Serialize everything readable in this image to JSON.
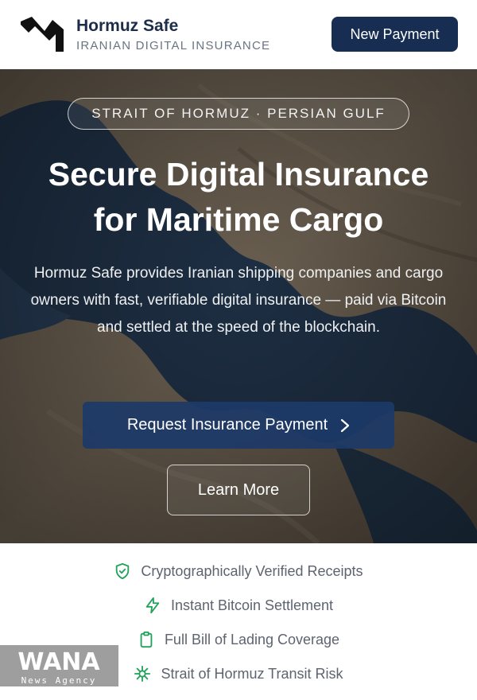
{
  "header": {
    "brand_title": "Hormuz Safe",
    "brand_subtitle": "IRANIAN DIGITAL INSURANCE",
    "new_payment_label": "New Payment"
  },
  "hero": {
    "region_pill": "STRAIT OF HORMUZ · PERSIAN GULF",
    "title_line1": "Secure Digital Insurance",
    "title_line2": "for Maritime Cargo",
    "description": "Hormuz Safe provides Iranian shipping companies and cargo owners with fast, verifiable digital insurance — paid via Bitcoin and settled at the speed of the blockchain.",
    "request_button_label": "Request Insurance Payment",
    "learn_more_label": "Learn More"
  },
  "features": [
    {
      "label": "Cryptographically Verified Receipts",
      "icon": "shield-check-icon"
    },
    {
      "label": "Instant Bitcoin Settlement",
      "icon": "lightning-icon"
    },
    {
      "label": "Full Bill of Lading Coverage",
      "icon": "clipboard-icon"
    },
    {
      "label": "Strait of Hormuz Transit Risk",
      "icon": "ship-wheel-icon"
    }
  ],
  "watermark": {
    "logo_text": "WANA",
    "caption": "News Agency"
  },
  "colors": {
    "brand_navy": "#172e52",
    "feature_green": "#22a25a",
    "text_gray": "#5d6470"
  }
}
